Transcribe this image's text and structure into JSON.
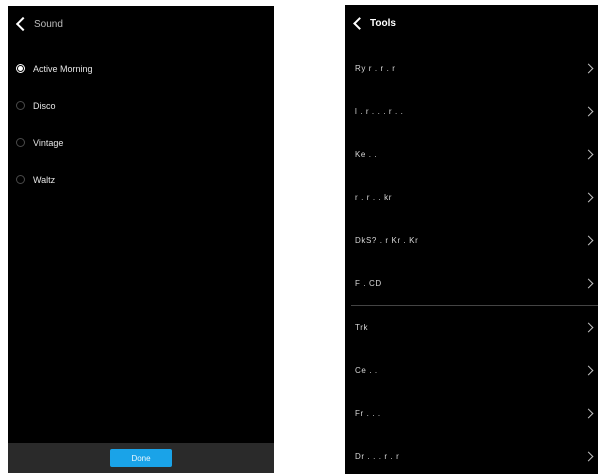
{
  "left_screen": {
    "header": {
      "title": "Sound"
    },
    "options": [
      {
        "label": "Active Morning",
        "selected": true
      },
      {
        "label": "Disco",
        "selected": false
      },
      {
        "label": "Vintage",
        "selected": false
      },
      {
        "label": "Waltz",
        "selected": false
      }
    ],
    "footer": {
      "done_label": "Done"
    },
    "colors": {
      "accent": "#1aa3e8",
      "background": "#000000",
      "footer_bg": "#2a2a2a"
    }
  },
  "right_screen": {
    "header": {
      "title": "Tools"
    },
    "items_group1": [
      {
        "label": "Ry r . r . r"
      },
      {
        "label": "l . r . . . r . ."
      },
      {
        "label": "Ke . ."
      },
      {
        "label": "r . r . . kr"
      },
      {
        "label": "DkS? . r Kr . Kr"
      },
      {
        "label": "F . CD"
      }
    ],
    "items_group2": [
      {
        "label": "Trk"
      },
      {
        "label": "Ce . ."
      },
      {
        "label": "Fr . . ."
      },
      {
        "label": "Dr . . . r . r"
      }
    ],
    "colors": {
      "background": "#000000",
      "divider": "#444444"
    }
  }
}
